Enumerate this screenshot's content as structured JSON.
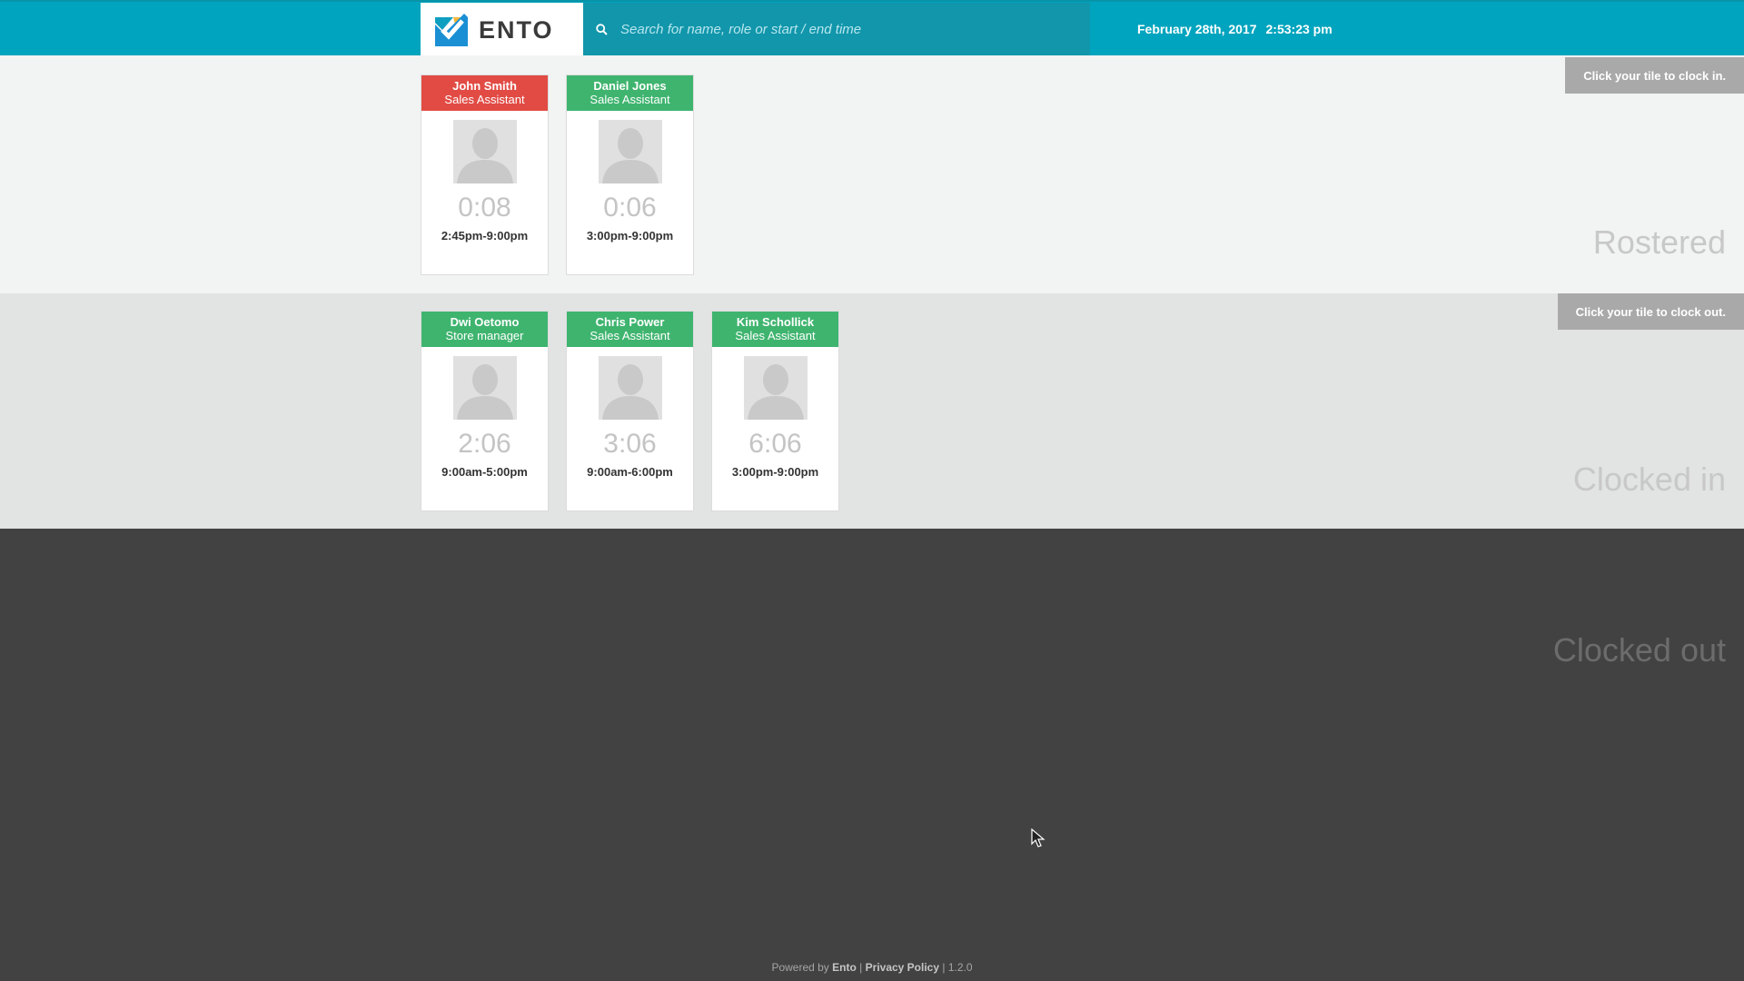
{
  "header": {
    "brand": "ENTO",
    "search_placeholder": "Search for name, role or start / end time",
    "date": "February 28th, 2017",
    "time": "2:53:23 pm"
  },
  "rostered": {
    "hint": "Click your tile to clock in.",
    "label": "Rostered",
    "tiles": [
      {
        "name": "John Smith",
        "role": "Sales Assistant",
        "elapsed": "0:08",
        "shift": "2:45pm-9:00pm",
        "status_color": "#e14b44"
      },
      {
        "name": "Daniel Jones",
        "role": "Sales Assistant",
        "elapsed": "0:06",
        "shift": "3:00pm-9:00pm",
        "status_color": "#3fb46f"
      }
    ]
  },
  "clocked_in": {
    "hint": "Click your tile to clock out.",
    "label": "Clocked in",
    "tiles": [
      {
        "name": "Dwi Oetomo",
        "role": "Store manager",
        "elapsed": "2:06",
        "shift": "9:00am-5:00pm",
        "status_color": "#3fb46f"
      },
      {
        "name": "Chris Power",
        "role": "Sales Assistant",
        "elapsed": "3:06",
        "shift": "9:00am-6:00pm",
        "status_color": "#3fb46f"
      },
      {
        "name": "Kim Schollick",
        "role": "Sales Assistant",
        "elapsed": "6:06",
        "shift": "3:00pm-9:00pm",
        "status_color": "#3fb46f"
      }
    ]
  },
  "clocked_out": {
    "label": "Clocked out"
  },
  "footer": {
    "powered_by": "Powered by",
    "brand_link": "Ento",
    "sep1": "|",
    "privacy_link": "Privacy Policy",
    "sep2": "|",
    "version": "1.2.0"
  },
  "icons": {
    "logo": "ento-logo-icon",
    "search": "search-icon",
    "avatar": "user-silhouette-icon",
    "cursor": "mouse-pointer-icon"
  }
}
